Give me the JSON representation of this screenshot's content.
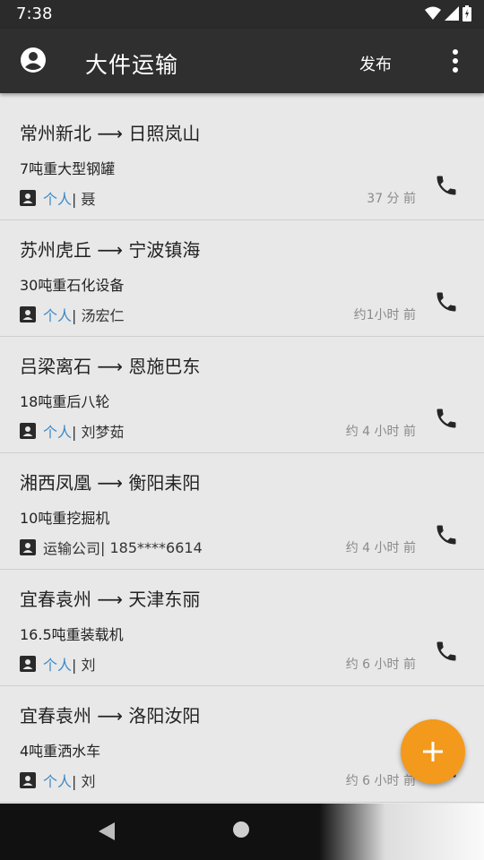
{
  "status_bar": {
    "time": "7:38"
  },
  "app_bar": {
    "title": "大件运输",
    "action_label": "发布",
    "account_icon": "account-circle-icon",
    "more_icon": "more-vert-icon"
  },
  "colors": {
    "accent": "#3d8ac7",
    "fab": "#f39a1c",
    "appbar": "#2f2f2f"
  },
  "listings": [
    {
      "route": "常州新北 ⟶ 日照岚山",
      "cargo": "7吨重大型钢罐",
      "type": "个人",
      "contact": " | 聂",
      "time": "37 分 前",
      "typeLinked": true
    },
    {
      "route": "苏州虎丘 ⟶ 宁波镇海",
      "cargo": "30吨重石化设备",
      "type": "个人",
      "contact": " | 汤宏仁",
      "time": "约1小时 前",
      "typeLinked": true
    },
    {
      "route": "吕梁离石 ⟶ 恩施巴东",
      "cargo": "18吨重后八轮",
      "type": "个人",
      "contact": " | 刘梦茹",
      "time": "约 4 小时 前",
      "typeLinked": true
    },
    {
      "route": "湘西凤凰 ⟶ 衡阳耒阳",
      "cargo": "10吨重挖掘机",
      "type": "运输公司",
      "contact": " | 185****6614",
      "time": "约 4 小时 前",
      "typeLinked": false
    },
    {
      "route": "宜春袁州 ⟶ 天津东丽",
      "cargo": "16.5吨重装载机",
      "type": "个人",
      "contact": " | 刘",
      "time": "约 6 小时 前",
      "typeLinked": true
    },
    {
      "route": "宜春袁州 ⟶ 洛阳汝阳",
      "cargo": "4吨重洒水车",
      "type": "个人",
      "contact": " | 刘",
      "time": "约 6 小时 前",
      "typeLinked": true
    }
  ],
  "fab": {
    "label": "+"
  }
}
